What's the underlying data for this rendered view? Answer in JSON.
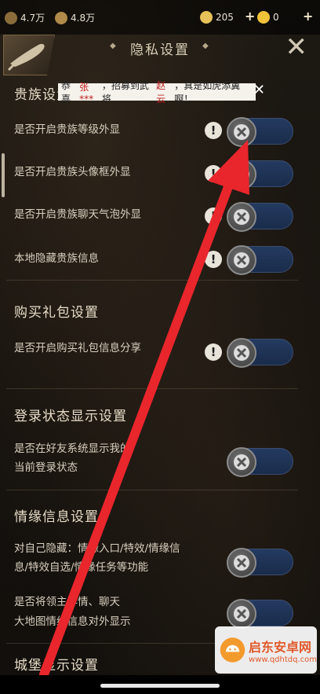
{
  "topbar": {
    "res1_value": "4.7万",
    "res2_value": "4.8万",
    "gold_value": "205",
    "ingot_value": "0",
    "plus": "+"
  },
  "header": {
    "title": "隐私设置",
    "deco_left": "◆",
    "deco_right": "◆",
    "close": "✕"
  },
  "notice": {
    "prefix": "恭喜",
    "name": "张***",
    "mid": "，招募到武将",
    "hero": "赵云",
    "suffix": "，真是如虎添翼啊！",
    "close": "✕"
  },
  "sections": [
    {
      "title": "贵族设置",
      "rows": [
        {
          "label": "是否开启贵族等级外显",
          "info": true
        },
        {
          "label": "是否开启贵族头像框外显",
          "info": true
        },
        {
          "label": "是否开启贵族聊天气泡外显",
          "info": true
        },
        {
          "label": "本地隐藏贵族信息",
          "info": true
        }
      ]
    },
    {
      "title": "购买礼包设置",
      "rows": [
        {
          "label": "是否开启购买礼包信息分享",
          "info": true
        }
      ]
    },
    {
      "title": "登录状态显示设置",
      "rows": [
        {
          "label_line1": "是否在好友系统显示我的",
          "label_line2": "当前登录状态",
          "info": false
        }
      ]
    },
    {
      "title": "情缘信息设置",
      "rows": [
        {
          "label_line1": "对自己隐藏：情缘入口/特效/情缘信",
          "label_line2": "息/特效自选/情缘任务等功能",
          "info": false
        },
        {
          "label_line1": "是否将领主详情、聊天",
          "label_line2": "大地图情缘信息对外显示",
          "info": false
        }
      ]
    },
    {
      "title": "城堡显示设置"
    }
  ],
  "info_glyph": "!",
  "watermark": {
    "name": "启东安卓网",
    "url": "www.qdhtdq.com"
  },
  "colors": {
    "toggle_track": "#243a60",
    "knob": "#4a4a4a",
    "arrow": "#e8262c",
    "notice_highlight": "#c01f1f"
  }
}
